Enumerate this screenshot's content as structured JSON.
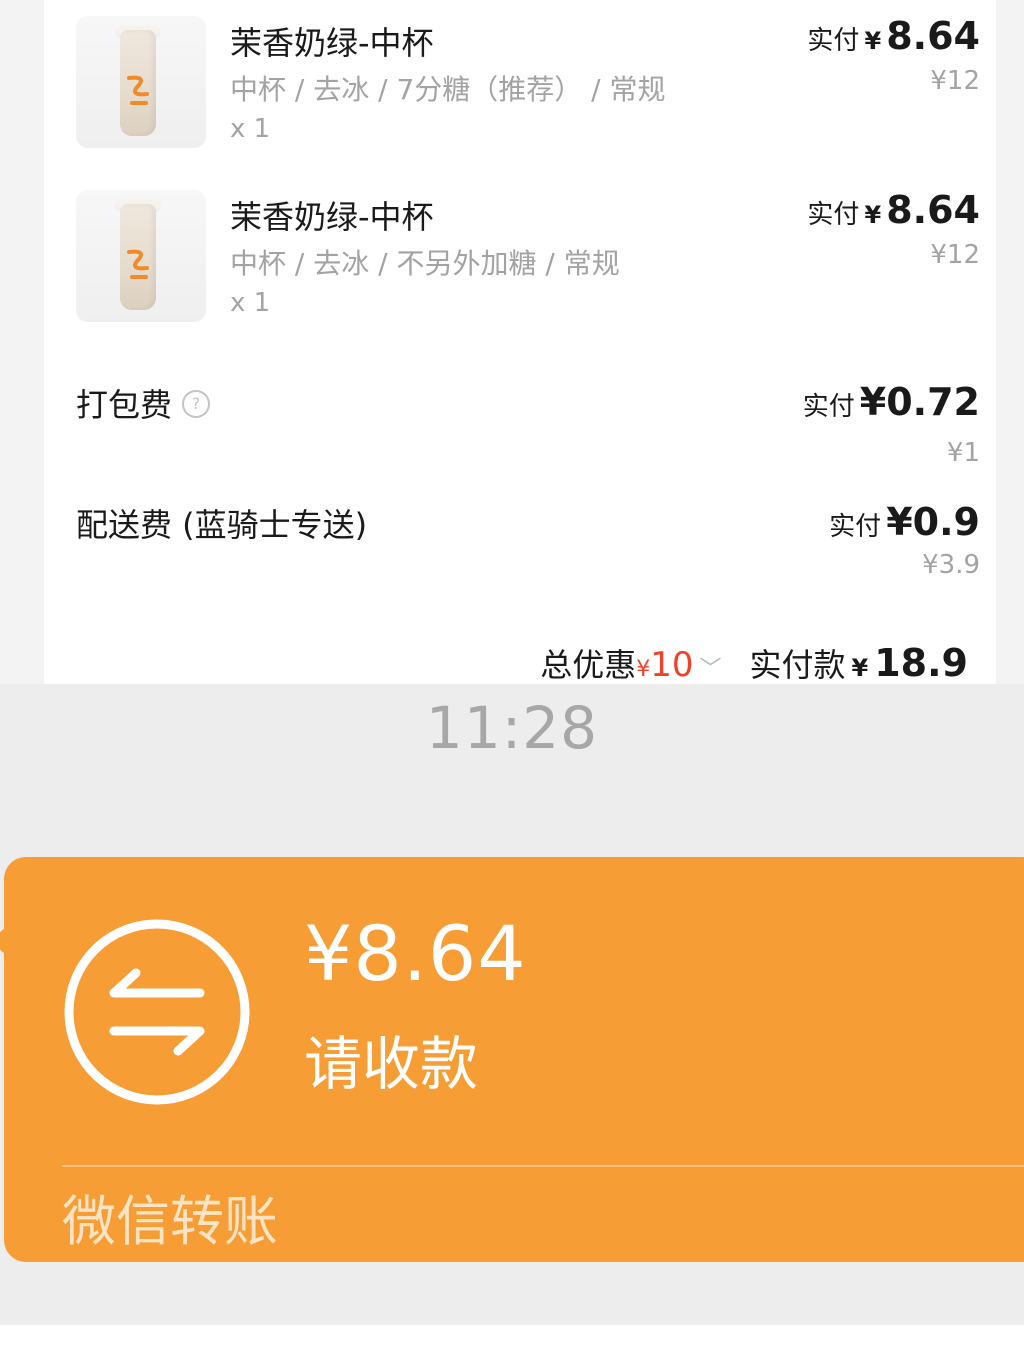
{
  "order": {
    "items": [
      {
        "name": "茉香奶绿-中杯",
        "spec": "中杯 / 去冰 / 7分糖（推荐） / 常规",
        "quantity": "x 1",
        "paid_label": "实付",
        "paid_currency": "¥",
        "paid_amount": "8.64",
        "original_price": "¥12"
      },
      {
        "name": "茉香奶绿-中杯",
        "spec": "中杯 / 去冰 / 不另外加糖 / 常规",
        "quantity": "x 1",
        "paid_label": "实付",
        "paid_currency": "¥",
        "paid_amount": "8.64",
        "original_price": "¥12"
      }
    ],
    "packing_fee": {
      "label": "打包费",
      "help_icon": "question-circle-icon",
      "paid_label": "实付",
      "paid_text": "¥0.72",
      "original_price": "¥1"
    },
    "delivery_fee": {
      "label": "配送费 (蓝骑士专送)",
      "paid_label": "实付",
      "paid_text": "¥0.9",
      "original_price": "¥3.9"
    },
    "summary": {
      "discount_label": "总优惠",
      "discount_currency": "¥",
      "discount_amount": "10",
      "total_label": "实付款",
      "total_currency": "¥",
      "total_amount": "18.9"
    }
  },
  "chat": {
    "time": "11:28",
    "transfer": {
      "icon": "transfer-arrows-icon",
      "amount": "¥8.64",
      "subtitle": "请收款",
      "footer": "微信转账",
      "color": "#f69d36"
    }
  },
  "colors": {
    "discount_red": "#f0412b",
    "transfer_orange": "#f69d36",
    "muted_gray": "#a3a3a3"
  }
}
